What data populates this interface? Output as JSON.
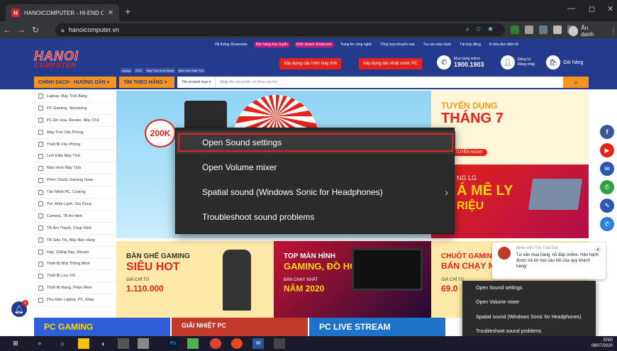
{
  "browser": {
    "tab_title": "HANOICOMPUTER - HI-END CO",
    "tab_close": "✕",
    "new_tab": "+",
    "url": "hanoicomputer.vn",
    "profile_name": "Ẩn danh",
    "window_controls": [
      "—",
      "◻",
      "✕"
    ]
  },
  "site": {
    "top_links": [
      {
        "label": "Hệ thống Showroom",
        "pill": false
      },
      {
        "label": "Bán hàng trực tuyến",
        "pill": true
      },
      {
        "label": "Kinh doanh showroom",
        "pill": true
      },
      {
        "label": "Trang tin công nghệ",
        "pill": false
      },
      {
        "label": "Tổng hợp khuyến mại",
        "pill": false
      },
      {
        "label": "Tra cứu bảo hành",
        "pill": false
      },
      {
        "label": "Tài hợp đồng",
        "pill": false
      },
      {
        "label": "In hóa đơn điện tử",
        "pill": false
      }
    ],
    "logo_top": "HANOI",
    "logo_bottom": "COMPUTER",
    "mini_tags": [
      "Laptop",
      "CPU",
      "Máy Tính Chơi Game",
      "Màn Hình Máy Tính"
    ],
    "build_pc": "Xây dựng cấu hình máy tính",
    "build_cooling": "Xây dựng tản nhiệt nước PC",
    "hotline_label": "Mua hàng online",
    "hotline_number": "1900.1903",
    "register": "Đăng ký",
    "login": "Đăng nhập",
    "cart": "Giỏ hàng",
    "cat_button": "CHÍNH SÁCH - HƯỚNG DẪN ▾",
    "brand_button": "TÌM THEO HÃNG ▾",
    "search_category": "Tất cả danh mục ▾",
    "search_placeholder": "Nhập tên sản phẩm, từ khóa cần tìm"
  },
  "left_menu": [
    "Laptop, Máy Tính Bảng",
    "PC Gaming, Streaming",
    "PC Đồ Họa, Render, Máy Chủ",
    "Máy Tính Văn Phòng",
    "Thiết Bị Văn Phòng",
    "Linh Kiện Máy Tính",
    "Màn Hình Máy Tính",
    "Phím Chuột, Gaming Gear",
    "Tản Nhiệt PC, Cooling",
    "Tivi, Điện Lạnh, Gia Dụng",
    "Camera, TB An Ninh",
    "TB Âm Thanh, Chụp Hình",
    "TB Siêu Thị, Máy Bán Hàng",
    "Họp, Giảng Dạy, Stream",
    "Thiết Bị Nhà Thông Minh",
    "Thiết Bị Lưu Trữ",
    "Thiết Bị Mạng, Phần Mềm",
    "Phụ Kiện Laptop, PC, Khác"
  ],
  "banners": {
    "main_badge": "200K",
    "right1_line1": "TUYỂN DỤNG",
    "right1_line2": "THÁNG 7",
    "right1_cta": "TUYỂN NGAY",
    "right2_line1": "NG LG",
    "right2_line2": "Á MÊ LY",
    "right2_line3": "RIỆU",
    "bottom1_a": "BÀN GHẾ GAMING",
    "bottom1_b": "SIÊU HOT",
    "bottom1_c": "GIÁ CHỈ TỪ",
    "bottom1_d": "1.110.000",
    "bottom2_a": "TOP MÀN HÌNH",
    "bottom2_b": "GAMING, ĐỒ HỌA",
    "bottom2_c": "BÁN CHẠY NHẤT",
    "bottom2_d": "NĂM 2020",
    "bottom3_a": "CHUỘT GAMIN",
    "bottom3_b": "BÁN CHẠY N",
    "bottom3_c": "GIÁ CHỈ TỪ",
    "bottom3_d": "69.0",
    "lower1": "PC GAMING",
    "lower2": "GIẢI NHIỆT PC",
    "lower3": "PC LIVE STREAM"
  },
  "chat": {
    "agent": "Nhân viên Tôn Thất Duy",
    "message": "Tư vấn mua hàng, hỗ đáp online. Hân hạnh được trả lời mọi câu hỏi của quý khách hàng!",
    "close": "✕"
  },
  "bell_count": "1",
  "sound_menu": {
    "items": [
      "Open Sound settings",
      "Open Volume mixer",
      "Spatial sound (Windows Sonic for Headphones)",
      "Troubleshoot sound problems"
    ],
    "highlighted_index": 0
  },
  "tray_menu": {
    "items": [
      "Open Sound settings",
      "Open Volume mixer",
      "Spatial sound (Windows Sonic for Headphones)",
      "Troubleshoot sound problems"
    ]
  },
  "taskbar": {
    "date": "08/07/2020",
    "time": "ENG"
  },
  "colors": {
    "brand_blue": "#243a8c",
    "brand_red": "#e4241b",
    "accent_orange": "#f7941d",
    "menu_bg": "#2b2b2b"
  }
}
